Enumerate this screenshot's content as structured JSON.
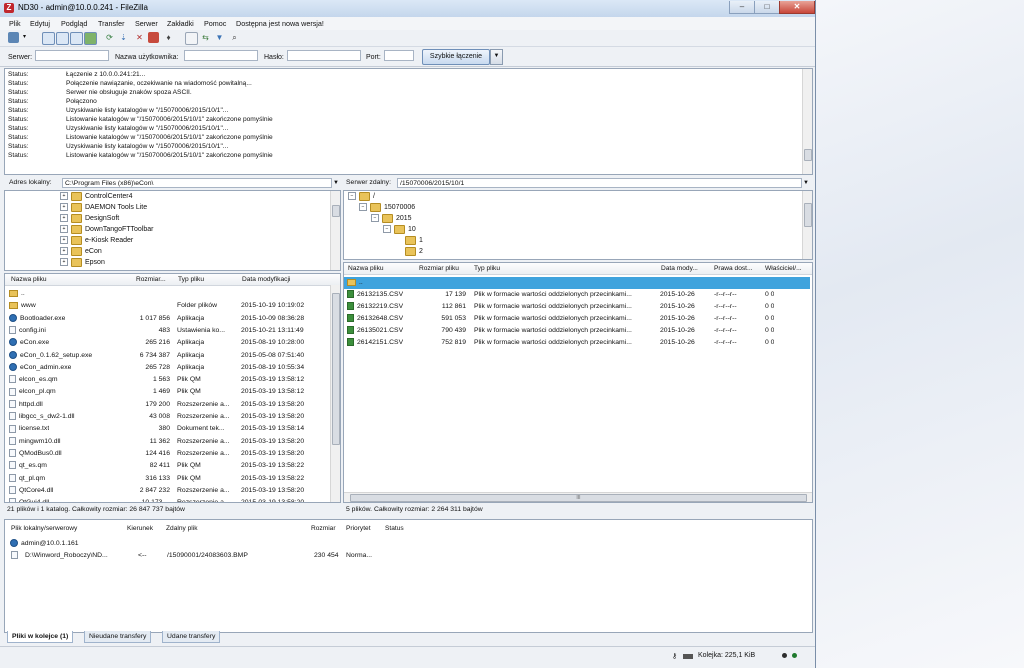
{
  "window": {
    "title": "ND30 - admin@10.0.0.241 - FileZilla",
    "app_icon": "Z",
    "controls": {
      "minimize": "–",
      "maximize": "□",
      "close": "✕"
    }
  },
  "menu": [
    "Plik",
    "Edytuj",
    "Podgląd",
    "Transfer",
    "Serwer",
    "Zakładki",
    "Pomoc",
    "Dostępna jest nowa wersja!"
  ],
  "toolbar": {
    "icons": [
      "site-manager-icon",
      "dropdown-icon",
      "toggle-log-icon",
      "toggle-local-tree-icon",
      "toggle-remote-tree-icon",
      "toggle-queue-icon",
      "refresh-icon",
      "process-queue-icon",
      "cancel-icon",
      "disconnect-icon",
      "reconnect-icon",
      "directory-comparison-icon",
      "sync-browsing-icon",
      "filter-icon",
      "search-icon"
    ]
  },
  "quickconnect": {
    "host_label": "Serwer:",
    "user_label": "Nazwa użytkownika:",
    "pass_label": "Hasło:",
    "port_label": "Port:",
    "host_value": "",
    "user_value": "",
    "pass_value": "",
    "port_value": "",
    "button_label": "Szybkie łączenie",
    "dropdown_arrow": "▼"
  },
  "log": [
    {
      "kind": "Status:",
      "msg": "Łączenie z 10.0.0.241:21..."
    },
    {
      "kind": "Status:",
      "msg": "Połączenie nawiązanie, oczekiwanie na wiadomość powitalną..."
    },
    {
      "kind": "Status:",
      "msg": "Serwer nie obsługuje znaków spoza ASCII."
    },
    {
      "kind": "Status:",
      "msg": "Połączono"
    },
    {
      "kind": "Status:",
      "msg": "Uzyskiwanie listy katalogów w \"/15070006/2015/10/1\"..."
    },
    {
      "kind": "Status:",
      "msg": "Listowanie katalogów w \"/15070006/2015/10/1\" zakończone pomyślnie"
    },
    {
      "kind": "Status:",
      "msg": "Uzyskiwanie listy katalogów w \"/15070006/2015/10/1\"..."
    },
    {
      "kind": "Status:",
      "msg": "Listowanie katalogów w \"/15070006/2015/10/1\" zakończone pomyślnie"
    },
    {
      "kind": "Status:",
      "msg": "Uzyskiwanie listy katalogów w \"/15070006/2015/10/1\"..."
    },
    {
      "kind": "Status:",
      "msg": "Listowanie katalogów w \"/15070006/2015/10/1\" zakończone pomyślnie"
    }
  ],
  "local": {
    "address_label": "Adres lokalny:",
    "address_value": "C:\\Program Files (x86)\\eCon\\",
    "tree": [
      {
        "label": "ControlCenter4",
        "exp": "+"
      },
      {
        "label": "DAEMON Tools Lite",
        "exp": "+"
      },
      {
        "label": "DesignSoft",
        "exp": "+"
      },
      {
        "label": "DownTangoFTToolbar",
        "exp": "+"
      },
      {
        "label": "e-Kiosk Reader",
        "exp": "+"
      },
      {
        "label": "eCon",
        "exp": "+"
      },
      {
        "label": "Epson",
        "exp": "+"
      }
    ],
    "columns": [
      "Nazwa pliku",
      "Rozmiar...",
      "Typ pliku",
      "Data modyfikacji"
    ],
    "files": [
      {
        "name": "..",
        "size": "",
        "type": "",
        "date": "",
        "icon": "up"
      },
      {
        "name": "www",
        "size": "",
        "type": "Folder plików",
        "date": "2015-10-19 10:19:02",
        "icon": "folder"
      },
      {
        "name": "Bootloader.exe",
        "size": "1 017 856",
        "type": "Aplikacja",
        "date": "2015-10-09 08:36:28",
        "icon": "exe"
      },
      {
        "name": "config.ini",
        "size": "483",
        "type": "Ustawienia ko...",
        "date": "2015-10-21 13:11:49",
        "icon": "file"
      },
      {
        "name": "eCon.exe",
        "size": "265 216",
        "type": "Aplikacja",
        "date": "2015-08-19 10:28:00",
        "icon": "exe"
      },
      {
        "name": "eCon_0.1.62_setup.exe",
        "size": "6 734 387",
        "type": "Aplikacja",
        "date": "2015-05-08 07:51:40",
        "icon": "exe"
      },
      {
        "name": "eCon_admin.exe",
        "size": "265 728",
        "type": "Aplikacja",
        "date": "2015-08-19 10:55:34",
        "icon": "exe"
      },
      {
        "name": "elcon_es.qm",
        "size": "1 563",
        "type": "Plik QM",
        "date": "2015-03-19 13:58:12",
        "icon": "file"
      },
      {
        "name": "elcon_pl.qm",
        "size": "1 469",
        "type": "Plik QM",
        "date": "2015-03-19 13:58:12",
        "icon": "file"
      },
      {
        "name": "httpd.dll",
        "size": "179 200",
        "type": "Rozszerzenie a...",
        "date": "2015-03-19 13:58:20",
        "icon": "file"
      },
      {
        "name": "libgcc_s_dw2-1.dll",
        "size": "43 008",
        "type": "Rozszerzenie a...",
        "date": "2015-03-19 13:58:20",
        "icon": "file"
      },
      {
        "name": "license.txt",
        "size": "380",
        "type": "Dokument tek...",
        "date": "2015-03-19 13:58:14",
        "icon": "file"
      },
      {
        "name": "mingwm10.dll",
        "size": "11 362",
        "type": "Rozszerzenie a...",
        "date": "2015-03-19 13:58:20",
        "icon": "file"
      },
      {
        "name": "QModBus0.dll",
        "size": "124 416",
        "type": "Rozszerzenie a...",
        "date": "2015-03-19 13:58:20",
        "icon": "file"
      },
      {
        "name": "qt_es.qm",
        "size": "82 411",
        "type": "Plik QM",
        "date": "2015-03-19 13:58:22",
        "icon": "file"
      },
      {
        "name": "qt_pl.qm",
        "size": "316 133",
        "type": "Plik QM",
        "date": "2015-03-19 13:58:22",
        "icon": "file"
      },
      {
        "name": "QtCore4.dll",
        "size": "2 847 232",
        "type": "Rozszerzenie a...",
        "date": "2015-03-19 13:58:20",
        "icon": "file"
      },
      {
        "name": "QtGui4.dll",
        "size": "10 173 ...",
        "type": "Rozszerzenie a...",
        "date": "2015-03-19 13:58:20",
        "icon": "file"
      }
    ],
    "status": "21 plików i 1 katalog. Całkowity rozmiar: 26 847 737 bajtów"
  },
  "remote": {
    "address_label": "Serwer zdalny:",
    "address_value": "/15070006/2015/10/1",
    "tree": [
      {
        "label": "/",
        "exp": "−"
      },
      {
        "label": "15070006",
        "exp": "−"
      },
      {
        "label": "2015",
        "exp": "−"
      },
      {
        "label": "10",
        "exp": "−"
      },
      {
        "label": "1",
        "exp": ""
      },
      {
        "label": "2",
        "exp": ""
      }
    ],
    "columns": [
      "Nazwa pliku",
      "Rozmiar pliku",
      "Typ pliku",
      "Data mody...",
      "Prawa dost...",
      "Właściciel/..."
    ],
    "files": [
      {
        "name": "..",
        "size": "",
        "type": "",
        "date": "",
        "perms": "",
        "owner": "",
        "icon": "up",
        "selected": true
      },
      {
        "name": "26132135.CSV",
        "size": "17 139",
        "type": "Plik w formacie wartości oddzielonych przecinkami...",
        "date": "2015-10-26",
        "perms": "-r--r--r--",
        "owner": "0 0",
        "icon": "csv"
      },
      {
        "name": "26132219.CSV",
        "size": "112 861",
        "type": "Plik w formacie wartości oddzielonych przecinkami...",
        "date": "2015-10-26",
        "perms": "-r--r--r--",
        "owner": "0 0",
        "icon": "csv"
      },
      {
        "name": "26132648.CSV",
        "size": "591 053",
        "type": "Plik w formacie wartości oddzielonych przecinkami...",
        "date": "2015-10-26",
        "perms": "-r--r--r--",
        "owner": "0 0",
        "icon": "csv"
      },
      {
        "name": "26135021.CSV",
        "size": "790 439",
        "type": "Plik w formacie wartości oddzielonych przecinkami...",
        "date": "2015-10-26",
        "perms": "-r--r--r--",
        "owner": "0 0",
        "icon": "csv"
      },
      {
        "name": "26142151.CSV",
        "size": "752 819",
        "type": "Plik w formacie wartości oddzielonych przecinkami...",
        "date": "2015-10-26",
        "perms": "-r--r--r--",
        "owner": "0 0",
        "icon": "csv"
      }
    ],
    "status": "5 plików. Całkowity rozmiar: 2 264 311 bajtów",
    "hscroll_grip": "III"
  },
  "queue": {
    "columns": [
      "Plik lokalny/serwerowy",
      "Kierunek",
      "Zdalny plik",
      "Rozmiar",
      "Priorytet",
      "Status"
    ],
    "server": "admin@10.0.1.161",
    "item": {
      "local": "D:\\Winword_Roboczy\\ND...",
      "direction": "<--",
      "remote": "/15090001/24083603.BMP",
      "size": "230 454",
      "priority": "Norma...",
      "status": ""
    }
  },
  "tabs": [
    "Pliki w kolejce (1)",
    "Nieudane transfery",
    "Udane transfery"
  ],
  "statusbar": {
    "queue": "Kolejka: 225,1 KiB"
  },
  "colors": {
    "selected_row": "#3fa3dd",
    "folder": "#e9c35a",
    "accent": "#6f8fb8"
  }
}
